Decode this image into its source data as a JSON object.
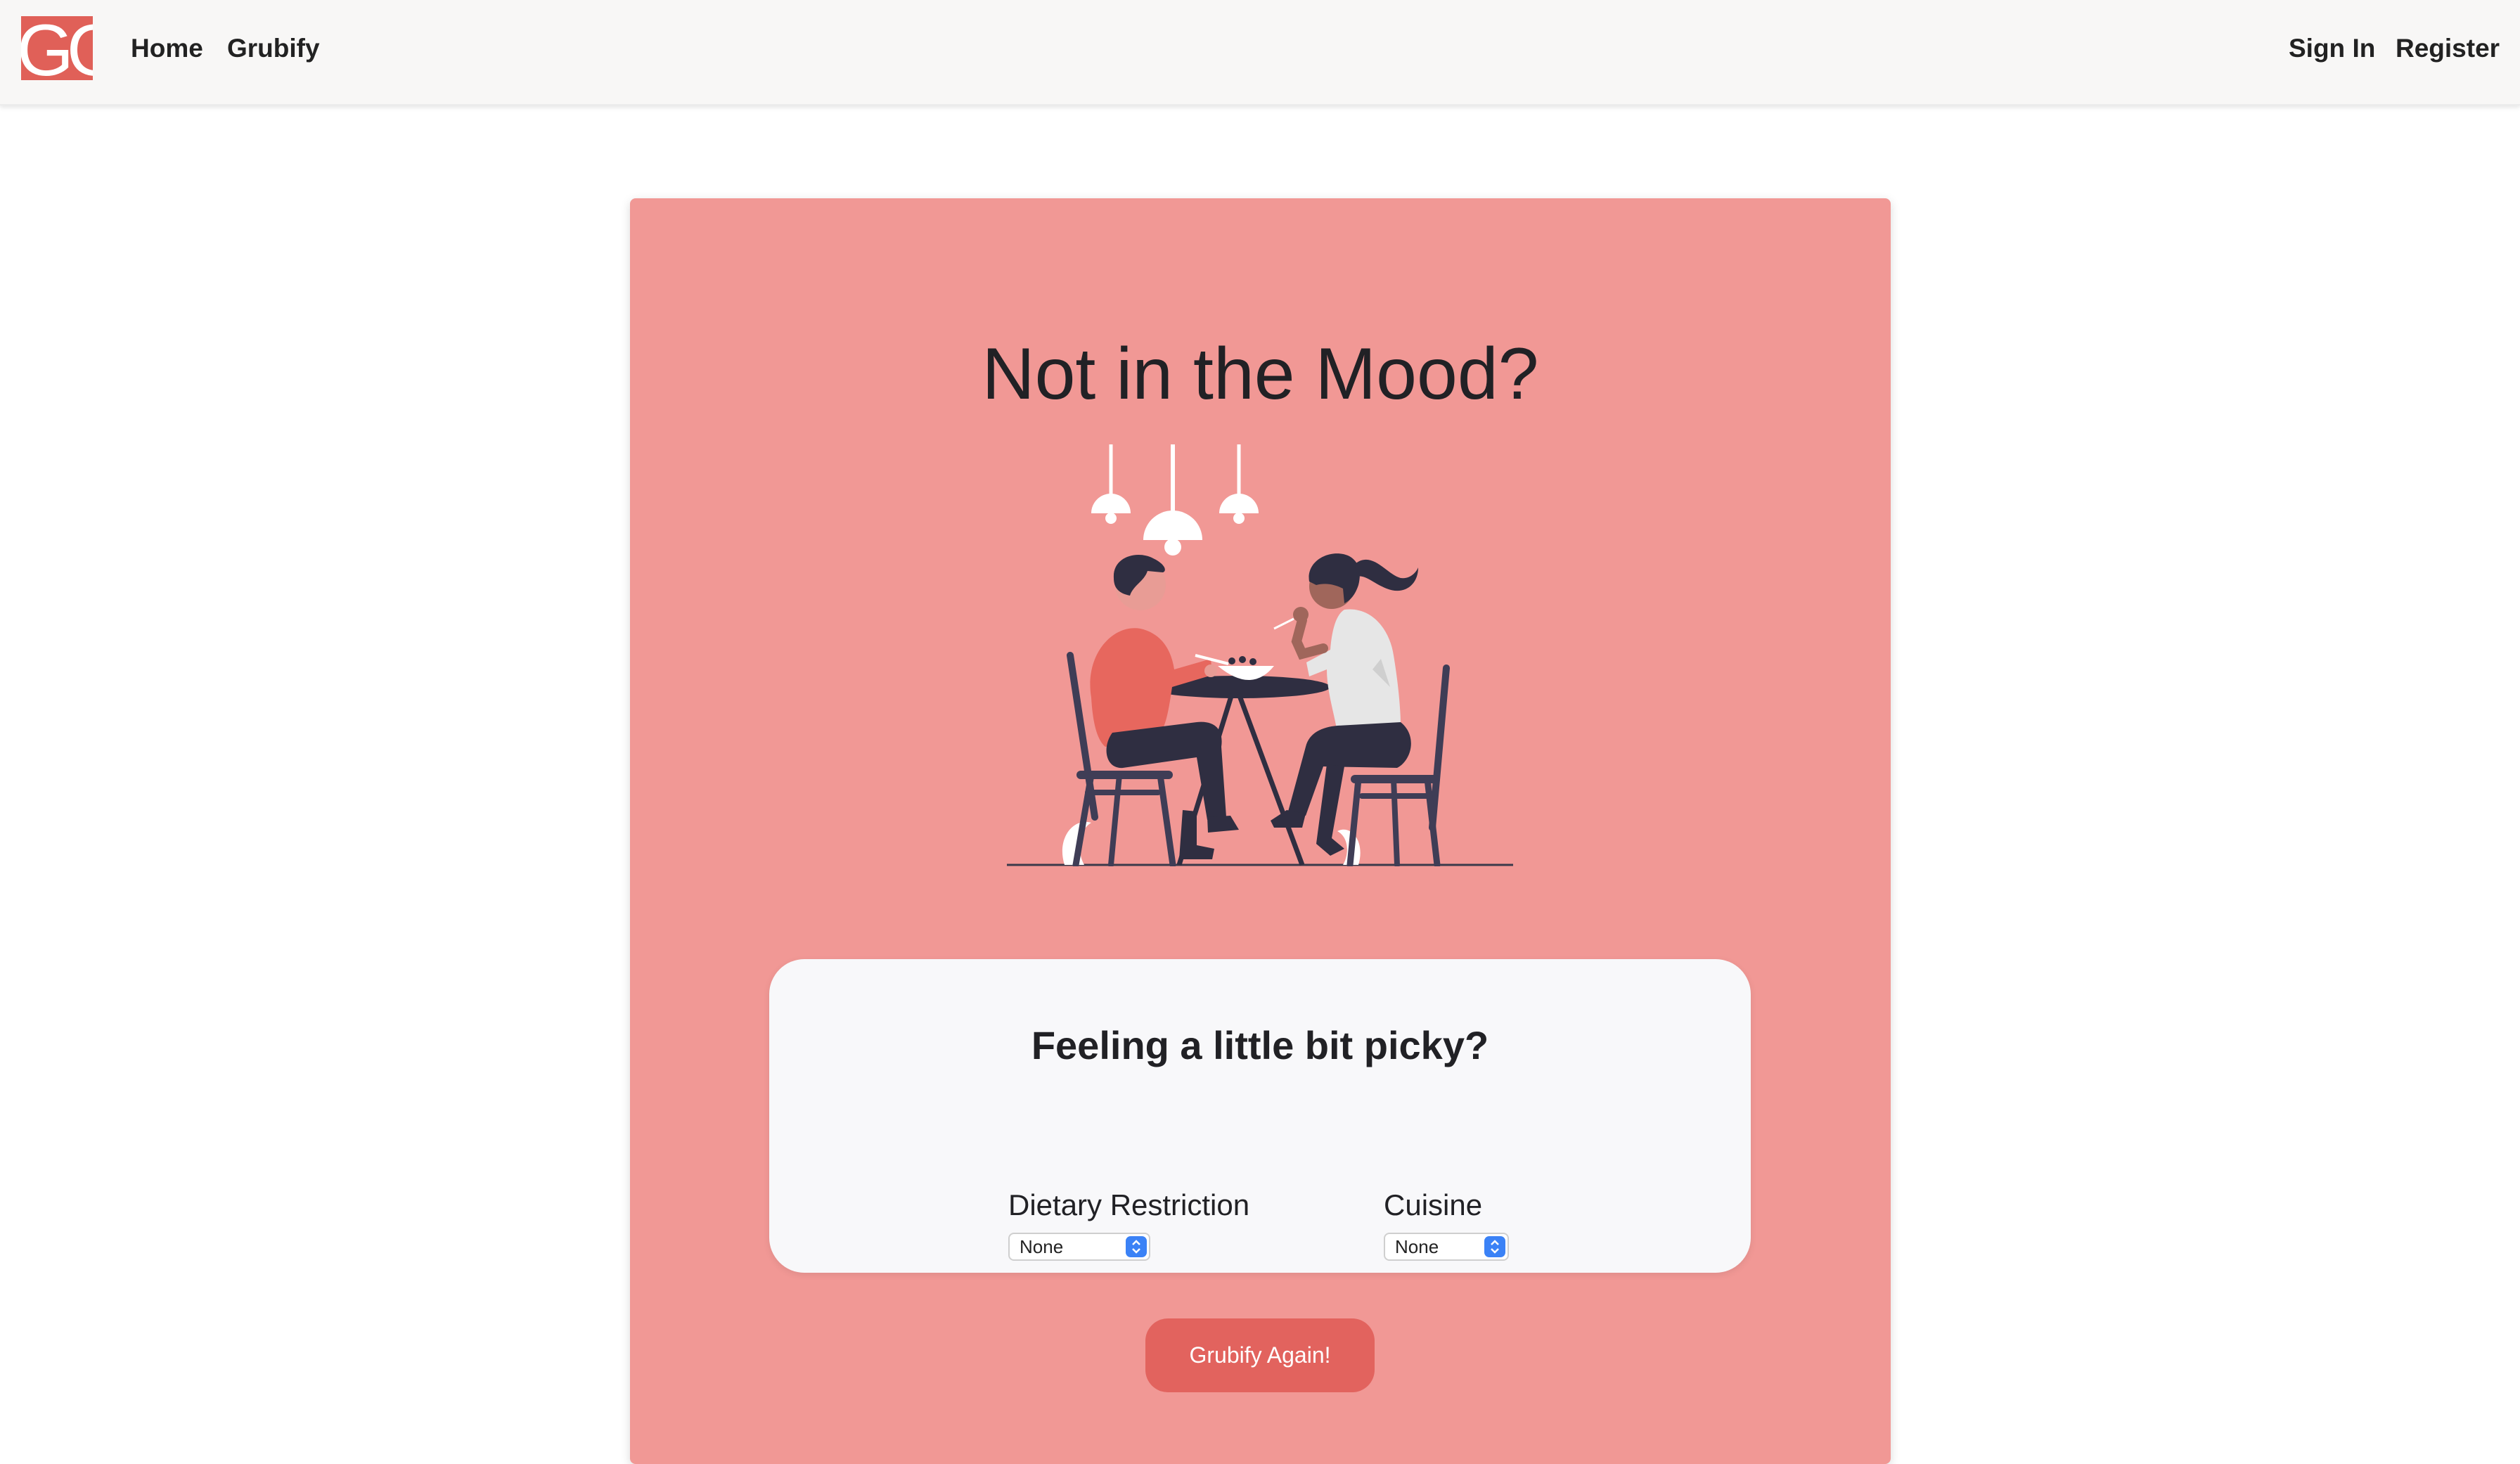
{
  "navbar": {
    "logo_text": "GG",
    "links": [
      {
        "label": "Home"
      },
      {
        "label": "Grubify"
      }
    ],
    "right_links": [
      {
        "label": "Sign In"
      },
      {
        "label": "Register"
      }
    ]
  },
  "main": {
    "headline": "Not in the Mood?",
    "illustration": "couple-dining-illustration",
    "picky": {
      "title": "Feeling a little bit picky?",
      "dietary": {
        "label": "Dietary Restriction",
        "selected": "None"
      },
      "cuisine": {
        "label": "Cuisine",
        "selected": "None"
      }
    },
    "action_button": "Grubify Again!"
  },
  "colors": {
    "card_bg": "#f19895",
    "accent": "#e2635e",
    "navbar_bg": "#f8f7f6",
    "panel_bg": "#f8f8fa",
    "text_dark": "#212125"
  }
}
